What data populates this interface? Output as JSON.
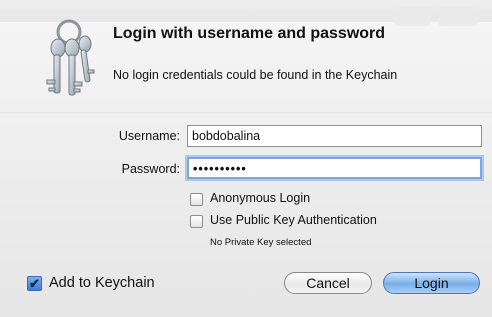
{
  "dialog": {
    "title": "Login with username and password",
    "subtitle": "No login credentials could be found in the Keychain"
  },
  "form": {
    "username_label": "Username:",
    "username_value": "bobdobalina",
    "password_label": "Password:",
    "password_value": "••••••••••"
  },
  "options": {
    "anonymous_label": "Anonymous Login",
    "anonymous_checked": false,
    "public_key_label": "Use Public Key Authentication",
    "public_key_checked": false,
    "private_key_note": "No Private Key selected"
  },
  "footer": {
    "keychain_label": "Add to Keychain",
    "keychain_checked": true,
    "keychain_check_glyph": "✔",
    "cancel_label": "Cancel",
    "login_label": "Login"
  },
  "icons": {
    "keys": "keys-icon",
    "checkbox_checked": "checkmark-icon"
  },
  "colors": {
    "focus_ring": "#7aa7e0",
    "default_button": "#77aee9",
    "checkbox_checked": "#3a7bd5"
  }
}
